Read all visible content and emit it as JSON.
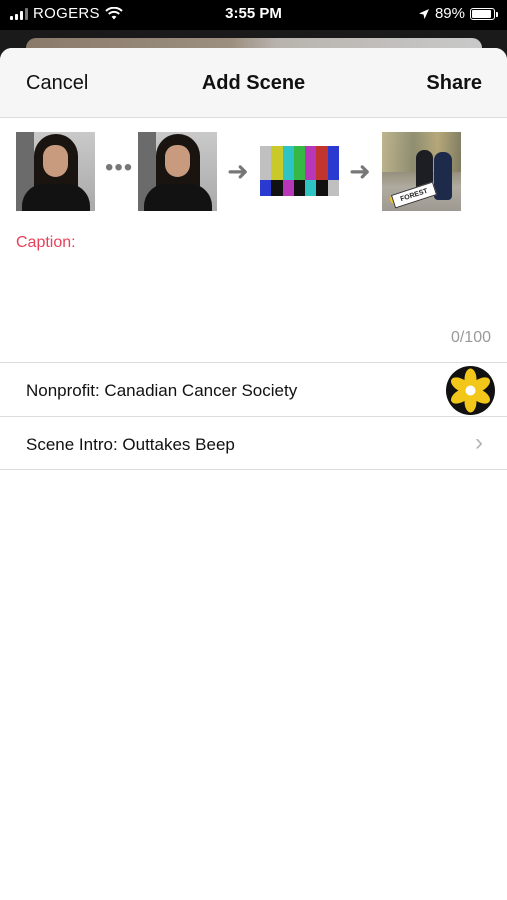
{
  "status_bar": {
    "carrier": "ROGERS",
    "time": "3:55 PM",
    "battery_percent": "89%",
    "battery_level": 0.89,
    "icons": [
      "signal-icon",
      "wifi-icon",
      "location-arrow-icon",
      "battery-icon"
    ]
  },
  "navbar": {
    "cancel_label": "Cancel",
    "title": "Add Scene",
    "share_label": "Share"
  },
  "scene_strip": {
    "thumbnails": [
      "first-frame-thumbnail",
      "last-frame-thumbnail",
      "intro-color-bars-thumbnail",
      "final-scene-thumbnail"
    ],
    "sticker_text": "FOREST",
    "icons": [
      "ellipsis-icon",
      "arrow-right-icon",
      "arrow-right-icon"
    ],
    "bar_colors": [
      "#c0c0c0",
      "#c9c92a",
      "#2fc4c4",
      "#35b845",
      "#b836b8",
      "#c2352f",
      "#2a3ad0"
    ],
    "bottom_colors": [
      "#2a3ad0",
      "#111111",
      "#b836b8",
      "#111111",
      "#2fc4c4",
      "#111111",
      "#c0c0c0"
    ]
  },
  "caption": {
    "label": "Caption:",
    "value": "",
    "counter": "0/100",
    "color": "#e8415a"
  },
  "rows": [
    {
      "label": "Nonprofit: Canadian Cancer Society",
      "icon": "daffodil-logo-icon"
    },
    {
      "label": "Scene Intro: Outtakes Beep",
      "icon": "chevron-right-icon"
    }
  ]
}
